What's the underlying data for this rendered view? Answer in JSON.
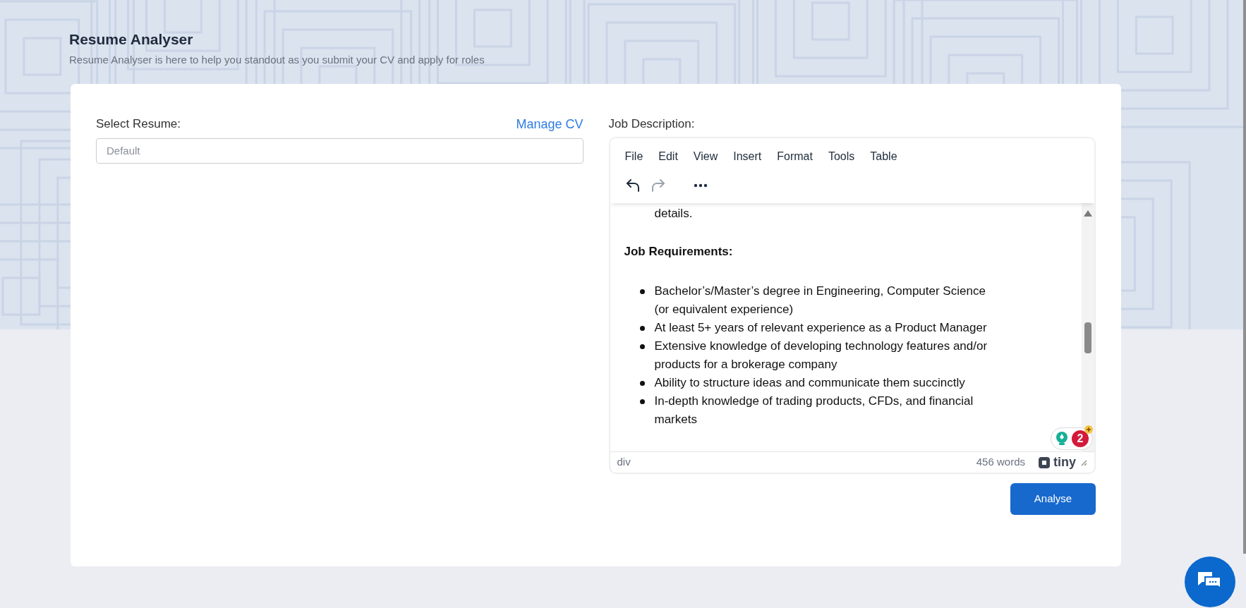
{
  "header": {
    "title": "Resume Analyser",
    "subtitle": "Resume Analyser is here to help you standout as you submit your CV and apply for roles"
  },
  "resume": {
    "label": "Select Resume:",
    "link": "Manage CV",
    "placeholder": "Default"
  },
  "job_description": {
    "label": "Job Description:",
    "menu": [
      "File",
      "Edit",
      "View",
      "Insert",
      "Format",
      "Tools",
      "Table"
    ],
    "toolbar": [
      {
        "kind": "undo",
        "disabled": false
      },
      {
        "kind": "redo",
        "disabled": true
      },
      {
        "kind": "more",
        "disabled": false
      }
    ],
    "content": [
      {
        "kind": "continuation",
        "text": "details."
      },
      {
        "kind": "heading",
        "text": "Job Requirements:"
      },
      {
        "kind": "bullet",
        "text": "Bachelor’s/Master’s degree in Engineering, Computer Science (or equivalent experience)"
      },
      {
        "kind": "bullet",
        "text": "At least 5+ years of relevant experience as a Product Manager"
      },
      {
        "kind": "bullet",
        "text": "Extensive knowledge of developing technology features and/or products for a brokerage company"
      },
      {
        "kind": "bullet",
        "text": "Ability to structure ideas and communicate them succinctly"
      },
      {
        "kind": "bullet",
        "text": "In-depth knowledge of trading products, CFDs, and financial markets"
      }
    ],
    "assistant_count": "2",
    "status_bar": {
      "path": "div",
      "word_count": "456 words",
      "brand": "tiny"
    }
  },
  "analyse_button": "Analyse"
}
